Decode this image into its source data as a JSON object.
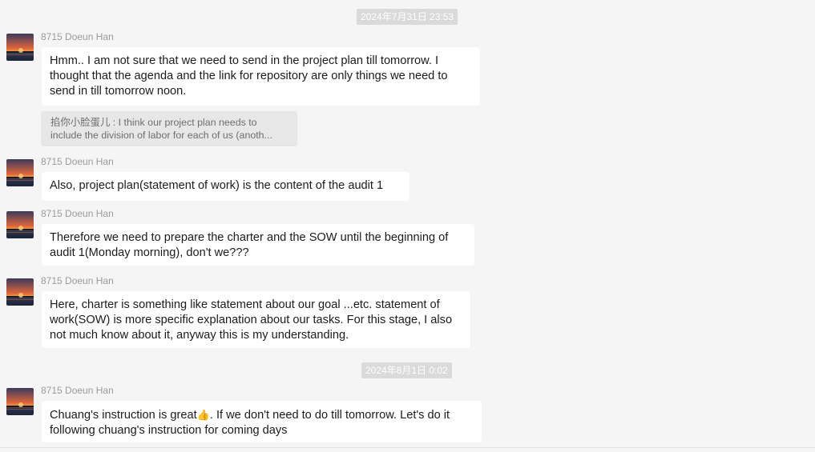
{
  "messages_area": {
    "timestamps": [
      "2024年7月31日 23:53",
      "2024年8月1日 0:02"
    ]
  },
  "messages": [
    {
      "sender": "8715 Doeun Han",
      "text": "Hmm.. I am not sure that we need to send in the project plan till tomorrow. I\nthought that the agenda and the link for repository are only things we need to\nsend in till tomorrow noon."
    },
    {
      "quote": "掐你小脸蛋儿 : I think our project plan needs to\ninclude the division of labor for each of us (anoth..."
    },
    {
      "sender": "8715 Doeun Han",
      "text": "Also, project plan(statement of work) is the content of the audit 1"
    },
    {
      "sender": "8715 Doeun Han",
      "text": "Therefore we need to prepare the charter and the SOW until the beginning of\naudit 1(Monday morning), don't we???"
    },
    {
      "sender": "8715 Doeun Han",
      "text": "Here, charter is something like statement about our goal ...etc. statement of\nwork(SOW) is more specific explanation about our tasks. For this stage, I also\nnot much know about it, anyway this is my understanding."
    },
    {
      "sender": "8715 Doeun Han",
      "text_before_emoji": "Chuang's instruction is great",
      "emoji": "👍",
      "text_after_emoji": ". If we don't need to do till tomorrow. Let's do it\nfollowing chuang's instruction for coming days"
    }
  ],
  "avatar": {
    "icon": "sunset-avatar-icon",
    "colors": {
      "sky_top": "#3b3a5c",
      "sky_glow": "#e0663a",
      "sun": "#f6b04a",
      "water": "#2a3550"
    }
  },
  "colors": {
    "background": "#f5f5f5",
    "bubble": "#ffffff",
    "timestamp_bg": "#dadada",
    "quote_bg": "#e7e7e7",
    "sender": "#9b9b9b"
  }
}
